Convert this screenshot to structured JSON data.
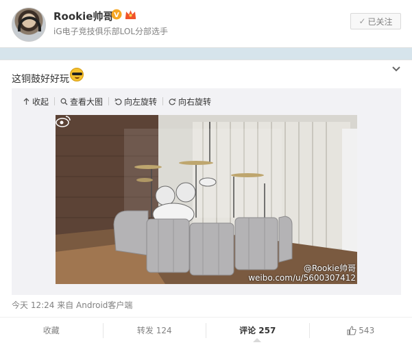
{
  "profile": {
    "name": "Rookie帅哥",
    "description": "iG电子竞技俱乐部LOL分部选手",
    "follow_label": "已关注",
    "follow_check": "✓"
  },
  "post": {
    "text": "这铜鼓好好玩",
    "toolbar": {
      "collapse": "收起",
      "view_large": "查看大图",
      "rotate_left": "向左旋转",
      "rotate_right": "向右旋转"
    },
    "watermark_user": "@Rookie帅哥",
    "watermark_url": "weibo.com/u/5600307412",
    "meta": "今天 12:24 来自 Android客户端"
  },
  "actions": {
    "favorite": "收藏",
    "repost": "转发 124",
    "comment": "评论 257",
    "like": "543"
  },
  "colors": {
    "accent_verify": "#f5a623",
    "page_bg": "#d6e4ec"
  }
}
